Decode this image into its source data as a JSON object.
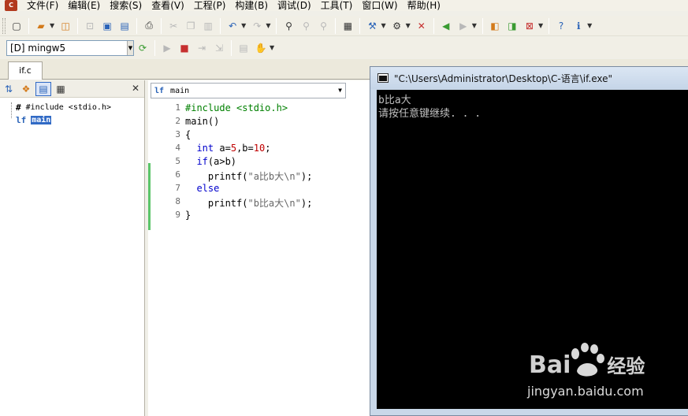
{
  "menu": {
    "app_icon_label": "C",
    "items": [
      "文件(F)",
      "编辑(E)",
      "搜索(S)",
      "查看(V)",
      "工程(P)",
      "构建(B)",
      "调试(D)",
      "工具(T)",
      "窗口(W)",
      "帮助(H)"
    ]
  },
  "toolbar": {
    "compiler_value": "[D] mingw5"
  },
  "tabs": {
    "active_file": "if.c"
  },
  "left_panel": {
    "tree": [
      {
        "icon": "#",
        "label": "#include <stdio.h>"
      },
      {
        "icon": "lf",
        "label": "main"
      }
    ]
  },
  "editor": {
    "function_select_icon": "lf",
    "function_select": "main",
    "line_numbers": [
      "1",
      "2",
      "3",
      "4",
      "5",
      "6",
      "7",
      "8",
      "9"
    ],
    "lines": [
      [
        {
          "t": "#include <stdio.h>",
          "c": "pp"
        }
      ],
      [
        {
          "t": "main()",
          "c": "plain"
        }
      ],
      [
        {
          "t": "{",
          "c": "plain"
        }
      ],
      [
        {
          "t": "  ",
          "c": "plain"
        },
        {
          "t": "int",
          "c": "kw"
        },
        {
          "t": " a=",
          "c": "plain"
        },
        {
          "t": "5",
          "c": "num"
        },
        {
          "t": ",b=",
          "c": "plain"
        },
        {
          "t": "10",
          "c": "num"
        },
        {
          "t": ";",
          "c": "plain"
        }
      ],
      [
        {
          "t": "  ",
          "c": "plain"
        },
        {
          "t": "if",
          "c": "kw"
        },
        {
          "t": "(a>b)",
          "c": "plain"
        }
      ],
      [
        {
          "t": "    printf(",
          "c": "plain"
        },
        {
          "t": "\"a比b大\\n\"",
          "c": "str"
        },
        {
          "t": ");",
          "c": "plain"
        }
      ],
      [
        {
          "t": "  ",
          "c": "plain"
        },
        {
          "t": "else",
          "c": "kw"
        }
      ],
      [
        {
          "t": "    printf(",
          "c": "plain"
        },
        {
          "t": "\"b比a大\\n\"",
          "c": "str"
        },
        {
          "t": ");",
          "c": "plain"
        }
      ],
      [
        {
          "t": "}",
          "c": "plain"
        }
      ]
    ]
  },
  "console": {
    "title": "\"C:\\Users\\Administrator\\Desktop\\C-语言\\if.exe\"",
    "output": [
      "b比a大",
      "请按任意键继续. . ."
    ]
  },
  "watermark": {
    "logo_left": "Bai",
    "logo_right": "经验",
    "url": "jingyan.baidu.com"
  },
  "colors": {
    "keyword": "#0000cc",
    "preprocessor": "#008000",
    "number": "#c00000",
    "string": "#666666",
    "console_bg": "#000000",
    "console_text": "#c0c0c0",
    "selection": "#316ac5",
    "change_bar": "#5bc56a"
  }
}
